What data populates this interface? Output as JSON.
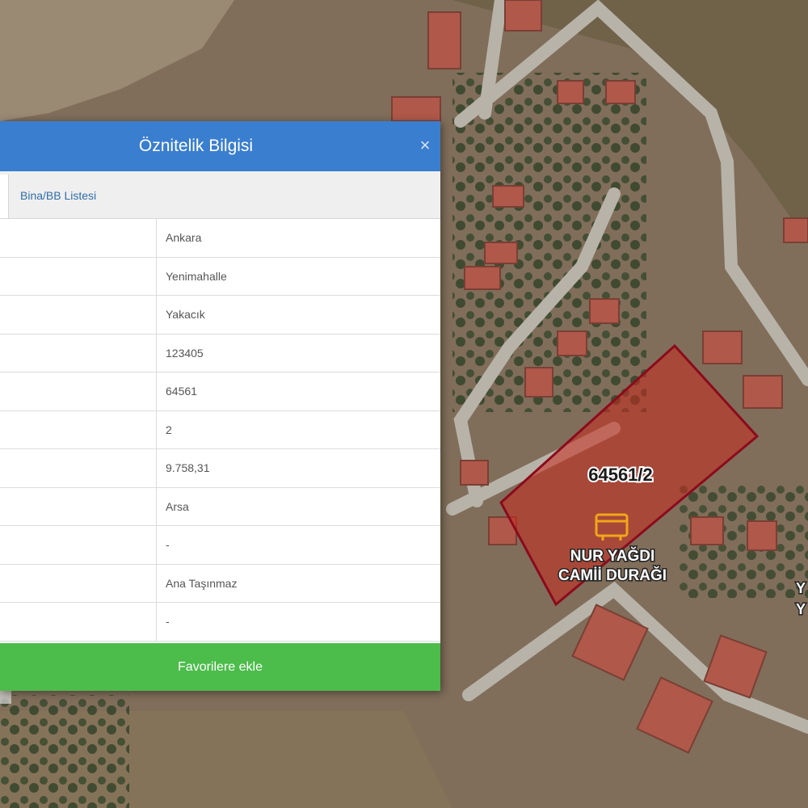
{
  "panel": {
    "title": "Öznitelik Bilgisi",
    "close_glyph": "×",
    "tab_label": "Bina/BB Listesi",
    "rows": [
      {
        "value": "Ankara"
      },
      {
        "value": "Yenimahalle"
      },
      {
        "value": "Yakacık"
      },
      {
        "value": "123405"
      },
      {
        "value": "64561"
      },
      {
        "value": "2"
      },
      {
        "value": "9.758,31"
      },
      {
        "value": "Arsa"
      },
      {
        "value": "-"
      },
      {
        "value": "Ana Taşınmaz"
      },
      {
        "value": "-"
      }
    ],
    "favorite_label": "Favorilere ekle"
  },
  "map": {
    "parcel_label": "64561/2",
    "poi_label_line1": "NUR YAĞDI",
    "poi_label_line2": "CAMİİ DURAĞI",
    "poi_icon": "bus-stop-icon",
    "edge_label_1": "Y",
    "edge_label_2": "Y"
  },
  "colors": {
    "header": "#3a7ecf",
    "button": "#4cbc4b",
    "parcel_stroke": "#8b0b1c",
    "poi_icon": "#f0a818"
  }
}
